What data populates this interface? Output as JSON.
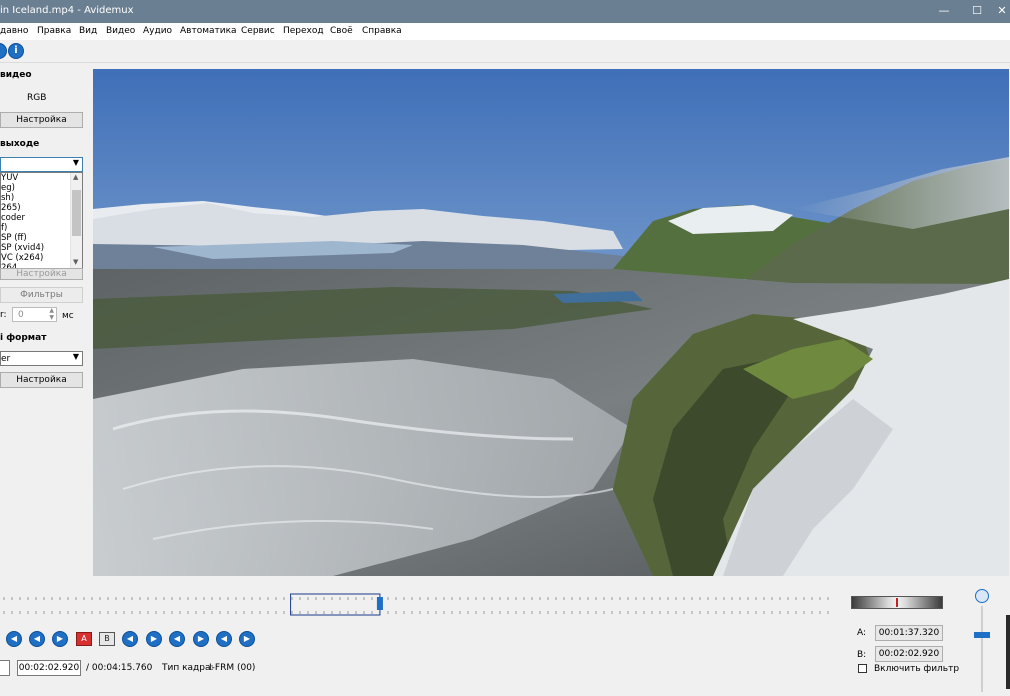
{
  "window": {
    "title": "in Iceland.mp4 - Avidemux",
    "controls": {
      "minimize": "—",
      "maximize": "☐",
      "close": "✕"
    }
  },
  "menu": [
    "давно",
    "Правка",
    "Вид",
    "Видео",
    "Аудио",
    "Автоматика",
    "Сервис",
    "Переход",
    "Своё",
    "Справка"
  ],
  "toolbar": {
    "info_icon": "info-icon",
    "info_glyph": "i"
  },
  "left_panel": {
    "video_section": "видео",
    "video_decoder_value": "RGB",
    "video_config_button": "Настройка",
    "output_section": "выходе",
    "output_combo_value": "",
    "output_options": [
      "YUV",
      "eg)",
      "sh)",
      "265)",
      "coder",
      "f)",
      "SP (ff)",
      "SP (xvid4)",
      "VC (x264)",
      "264"
    ],
    "hidden_config_button": "Настройка",
    "filters_button": "Фильтры",
    "shift_label": "r:",
    "shift_value": "0",
    "shift_unit": "мс",
    "format_section": "і формат",
    "format_combo_value": "er",
    "format_config_button": "Настройка"
  },
  "timeline": {
    "position_fraction": 0.455,
    "selection_start_fraction": 0.348,
    "selection_end_fraction": 0.455
  },
  "transport": {
    "icons": [
      "rewind-icon",
      "prev-keyframe-icon",
      "next-keyframe-icon",
      "set-marker-a-icon",
      "set-marker-b-icon",
      "prev-frame-icon",
      "next-frame-icon",
      "prev-black-icon",
      "next-black-icon",
      "goto-start-icon",
      "goto-end-icon"
    ],
    "marker_a_glyph": "A",
    "marker_b_glyph": "B"
  },
  "status": {
    "current_time": "00:02:02.920",
    "total_time": "/ 00:04:15.760",
    "frame_type_label": "Тип кадра:",
    "frame_type_value": "I-FRM (00)"
  },
  "ab": {
    "a_label": "A:",
    "a_value": "00:01:37.320",
    "b_label": "B:",
    "b_value": "00:02:02.920",
    "filter_checkbox_label": "Включить фильтр",
    "filter_checked": false
  },
  "colors": {
    "accent": "#1f6fc5",
    "titlebar": "#6b7f93",
    "marker_red": "#cc2020"
  }
}
